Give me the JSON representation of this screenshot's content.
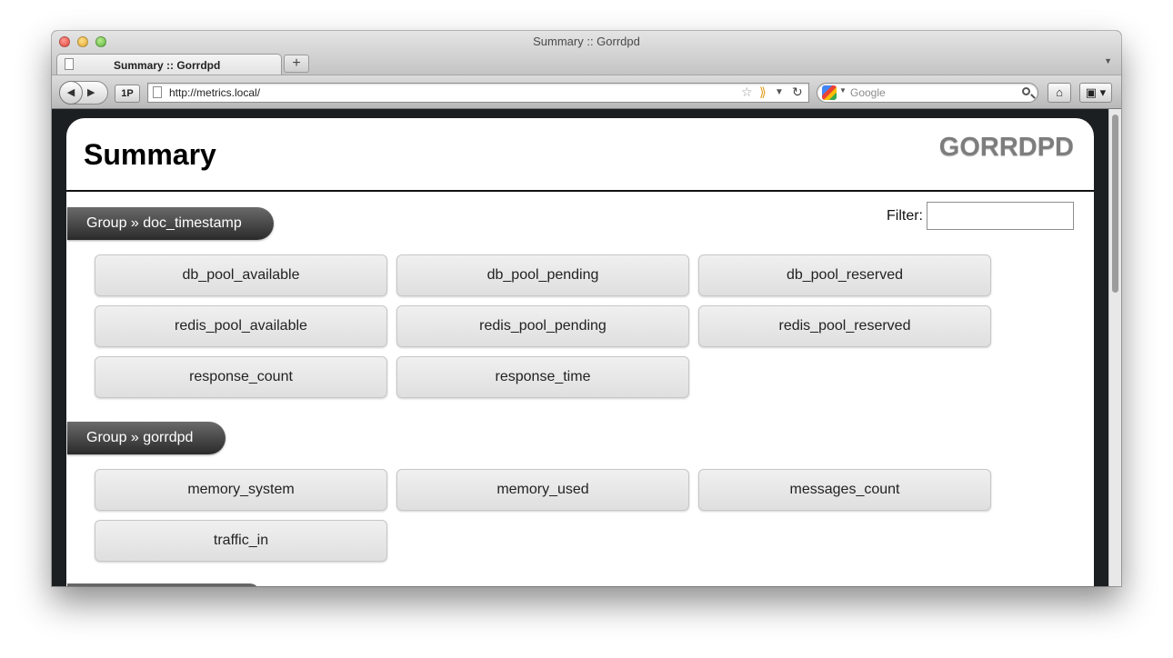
{
  "window": {
    "title": "Summary :: Gorrdpd"
  },
  "tabs": [
    {
      "label": "Summary :: Gorrdpd"
    }
  ],
  "toolbar": {
    "onepassword_label": "1P",
    "url": "http://metrics.local/",
    "search_placeholder": "Google"
  },
  "page": {
    "title": "Summary",
    "brand": "GORRDPD",
    "filter_label": "Filter:"
  },
  "groups": [
    {
      "label": "Group » doc_timestamp",
      "metrics": [
        "db_pool_available",
        "db_pool_pending",
        "db_pool_reserved",
        "redis_pool_available",
        "redis_pool_pending",
        "redis_pool_reserved",
        "response_count",
        "response_time"
      ]
    },
    {
      "label": "Group » gorrdpd",
      "metrics": [
        "memory_system",
        "memory_used",
        "messages_count",
        "traffic_in"
      ]
    }
  ],
  "icons": [
    "back-icon",
    "forward-icon",
    "page-icon",
    "bookmark-star-icon",
    "rss-icon",
    "history-dropdown-icon",
    "reload-icon",
    "google-icon",
    "search-icon",
    "home-icon",
    "bookmarks-icon",
    "new-tab-icon",
    "tab-list-icon"
  ]
}
